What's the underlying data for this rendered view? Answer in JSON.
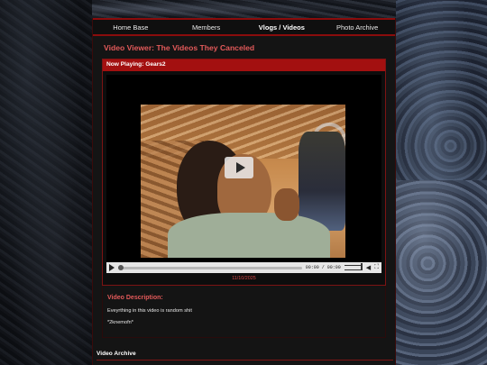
{
  "nav": {
    "items": [
      {
        "label": "Home Base"
      },
      {
        "label": "Members"
      },
      {
        "label": "Vlogs / Videos"
      },
      {
        "label": "Photo Archive"
      }
    ]
  },
  "page": {
    "title": "Video Viewer: The Videos They Canceled"
  },
  "viewer": {
    "now_playing": "Now Playing: Gears2",
    "time": "00:00 / 00:00",
    "date": "11/10/2025"
  },
  "description": {
    "title": "Video Description:",
    "line1": "Eveyrthing in this video is random shit",
    "line2": "*2knemofn*"
  },
  "archive": {
    "title": "Video Archive"
  },
  "colors": {
    "accent": "#a31010",
    "title": "#e35a5a"
  }
}
